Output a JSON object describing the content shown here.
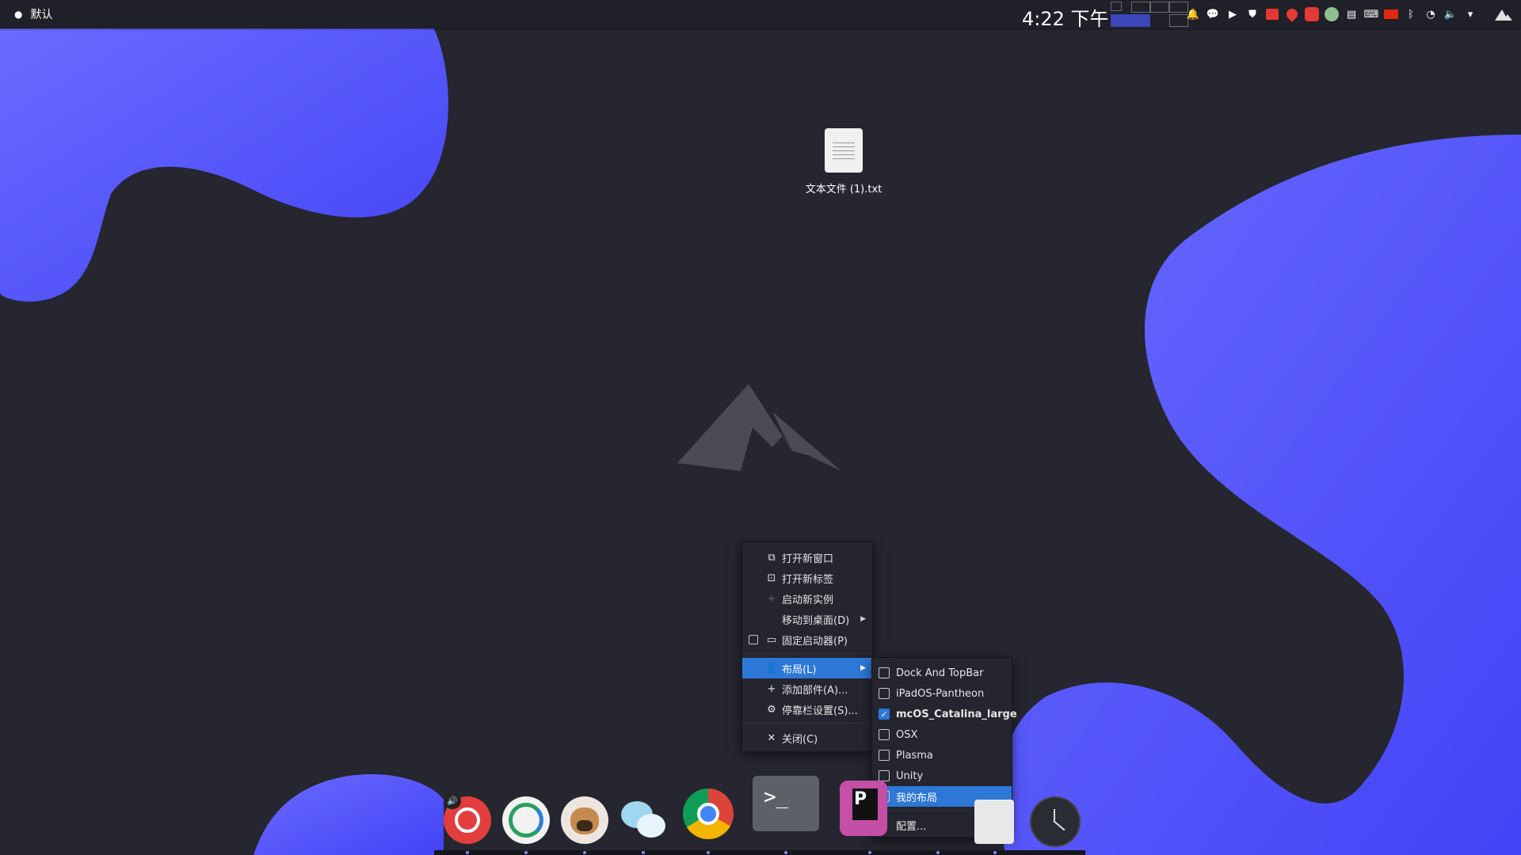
{
  "topbar": {
    "activity_label": "默认",
    "clock": "4:22 下午",
    "tray_icons": [
      "notification-bell",
      "wechat",
      "media-play",
      "shield",
      "record",
      "pocket",
      "netease-music",
      "avatar",
      "calendar",
      "keyboard",
      "flag-cn",
      "bluetooth",
      "wifi",
      "volume",
      "expand-arrow"
    ]
  },
  "desktop": {
    "file_label": "文本文件 (1).txt"
  },
  "context_menu": {
    "items": [
      {
        "label": "打开新窗口",
        "icon": "new-window-icon"
      },
      {
        "label": "打开新标签",
        "icon": "new-tab-icon"
      },
      {
        "label": "启动新实例",
        "icon": "plus-icon"
      },
      {
        "label": "移动到桌面(D)",
        "icon": "",
        "submenu": true
      },
      {
        "label": "固定启动器(P)",
        "icon": "pin-window-icon",
        "checkbox": true
      },
      {
        "label": "布局(L)",
        "icon": "user-icon",
        "submenu": true,
        "highlighted": true
      },
      {
        "label": "添加部件(A)...",
        "icon": "plus-icon"
      },
      {
        "label": "停靠栏设置(S)...",
        "icon": "gear-icon"
      },
      {
        "label": "关闭(C)",
        "icon": "close-icon"
      }
    ]
  },
  "layout_submenu": {
    "items": [
      {
        "label": "Dock And TopBar",
        "checked": false
      },
      {
        "label": "iPadOS-Pantheon",
        "checked": false
      },
      {
        "label": "mcOS_Catalina_large",
        "checked": true
      },
      {
        "label": "OSX",
        "checked": false
      },
      {
        "label": "Plasma",
        "checked": false
      },
      {
        "label": "Unity",
        "checked": false
      },
      {
        "label": "我的布局",
        "checked": false,
        "highlighted": true
      }
    ],
    "configure_label": "配置..."
  },
  "dock": {
    "apps": [
      "netease-cloud-music",
      "network-manager",
      "pug-app",
      "wechat",
      "google-chrome",
      "terminal",
      "pycharm",
      "file-manager",
      "clock"
    ]
  },
  "colors": {
    "accent": "#2d77d7",
    "wallpaper_blob": "#5b5bff",
    "background": "#25262f"
  }
}
